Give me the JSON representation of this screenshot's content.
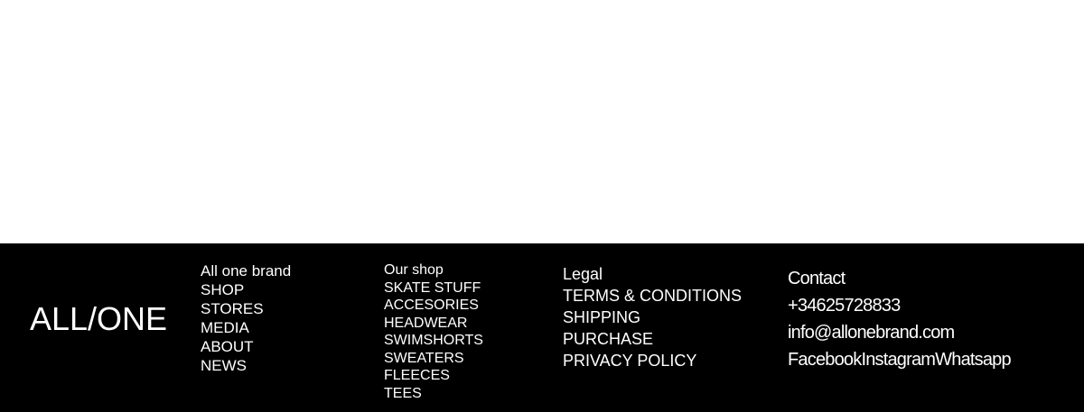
{
  "footer": {
    "logo": "ALL/ONE",
    "brand_column": {
      "heading": "All one brand",
      "links": [
        "SHOP",
        "STORES",
        "MEDIA",
        "ABOUT",
        "NEWS"
      ]
    },
    "shop_column": {
      "heading": "Our shop",
      "links": [
        "SKATE STUFF",
        "ACCESORIES",
        "HEADWEAR",
        "SWIMSHORTS",
        "SWEATERS",
        "FLEECES",
        "TEES"
      ]
    },
    "legal_column": {
      "heading": "Legal",
      "links": [
        "TERMS & CONDITIONS",
        "SHIPPING",
        "PURCHASE",
        "PRIVACY POLICY"
      ]
    },
    "contact_column": {
      "heading": "Contact",
      "phone": "+34625728833",
      "email": "info@allonebrand.com",
      "social": [
        "Facebook",
        "Instagram",
        "Whatsapp"
      ]
    }
  },
  "colors": {
    "footer_background": "#000000",
    "footer_text": "#ffffff",
    "page_background": "#ffffff"
  }
}
